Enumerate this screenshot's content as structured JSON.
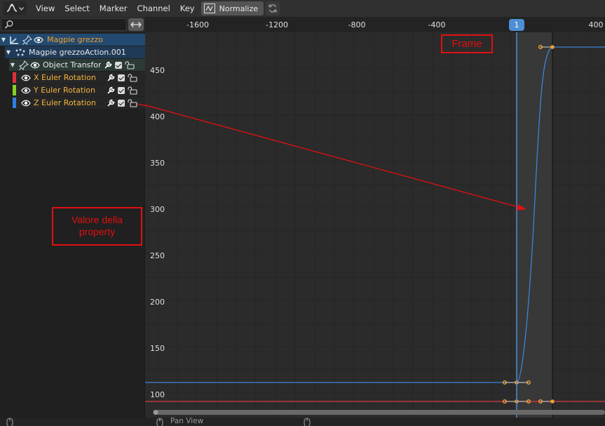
{
  "header": {
    "menus": [
      "View",
      "Select",
      "Marker",
      "Channel",
      "Key"
    ],
    "normalize_label": "Normalize",
    "editor_icon": "graph-editor-icon",
    "normalize_icon": "normalize-curve-icon",
    "refresh_icon": "refresh-icon"
  },
  "channels": {
    "search_placeholder": "",
    "object_name": "Magpie grezzo",
    "action_name": "Magpie grezzoAction.001",
    "group_name": "Object Transforms",
    "fcurves": [
      {
        "label": "X Euler Rotation",
        "color": "#e0303c"
      },
      {
        "label": "Y Euler Rotation",
        "color": "#86d220"
      },
      {
        "label": "Z Euler Rotation",
        "color": "#2e7fe0"
      }
    ]
  },
  "graph": {
    "x_ticks": [
      "-1600",
      "-1200",
      "-800",
      "-400",
      "400"
    ],
    "current_frame": "1",
    "y_ticks": [
      "450",
      "400",
      "350",
      "300",
      "250",
      "200",
      "150",
      "100"
    ]
  },
  "annotations": {
    "frame_label": "Frame",
    "value_label": "Valore della property",
    "color": "#e01010"
  },
  "footer": {
    "status": "Pan View"
  },
  "colors": {
    "selection_blue": "#4d8ed4",
    "active_keyframe": "#f0a030",
    "curve_blue": "#3d83d6",
    "curve_red": "#d43c3c"
  }
}
